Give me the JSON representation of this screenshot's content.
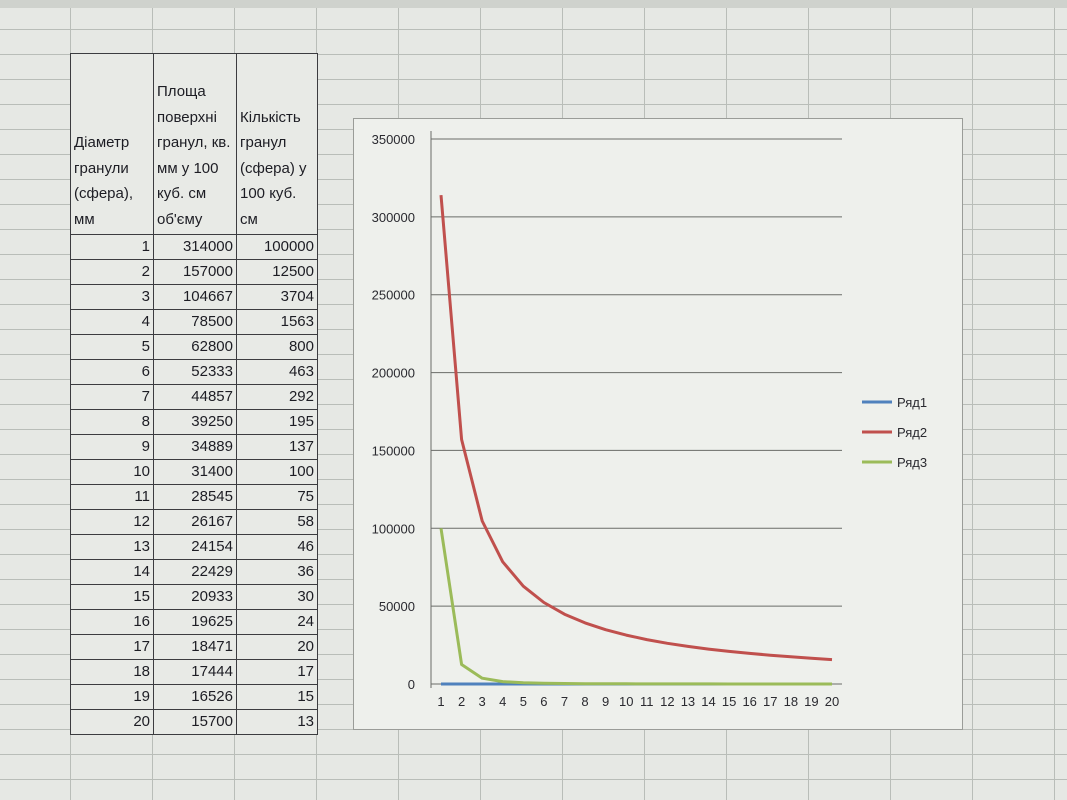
{
  "table": {
    "headers": [
      "Діаметр гранули (сфера), мм",
      "Площа поверхні гранул, кв. мм у 100 куб. см об'єму",
      "Кількість гранул (сфера) у 100 куб. см"
    ],
    "rows": [
      [
        1,
        314000,
        100000
      ],
      [
        2,
        157000,
        12500
      ],
      [
        3,
        104667,
        3704
      ],
      [
        4,
        78500,
        1563
      ],
      [
        5,
        62800,
        800
      ],
      [
        6,
        52333,
        463
      ],
      [
        7,
        44857,
        292
      ],
      [
        8,
        39250,
        195
      ],
      [
        9,
        34889,
        137
      ],
      [
        10,
        31400,
        100
      ],
      [
        11,
        28545,
        75
      ],
      [
        12,
        26167,
        58
      ],
      [
        13,
        24154,
        46
      ],
      [
        14,
        22429,
        36
      ],
      [
        15,
        20933,
        30
      ],
      [
        16,
        19625,
        24
      ],
      [
        17,
        18471,
        20
      ],
      [
        18,
        17444,
        17
      ],
      [
        19,
        16526,
        15
      ],
      [
        20,
        15700,
        13
      ]
    ]
  },
  "chart_data": {
    "type": "line",
    "x": [
      1,
      2,
      3,
      4,
      5,
      6,
      7,
      8,
      9,
      10,
      11,
      12,
      13,
      14,
      15,
      16,
      17,
      18,
      19,
      20
    ],
    "ylim": [
      0,
      350000
    ],
    "yticks": [
      0,
      50000,
      100000,
      150000,
      200000,
      250000,
      300000,
      350000
    ],
    "grid": true,
    "legend_position": "right",
    "series": [
      {
        "name": "Ряд1",
        "color": "#4f81bd",
        "values": [
          1,
          2,
          3,
          4,
          5,
          6,
          7,
          8,
          9,
          10,
          11,
          12,
          13,
          14,
          15,
          16,
          17,
          18,
          19,
          20
        ]
      },
      {
        "name": "Ряд2",
        "color": "#c0504d",
        "values": [
          314000,
          157000,
          104667,
          78500,
          62800,
          52333,
          44857,
          39250,
          34889,
          31400,
          28545,
          26167,
          24154,
          22429,
          20933,
          19625,
          18471,
          17444,
          16526,
          15700
        ]
      },
      {
        "name": "Ряд3",
        "color": "#9bbb59",
        "values": [
          100000,
          12500,
          3704,
          1563,
          800,
          463,
          292,
          195,
          137,
          100,
          75,
          58,
          46,
          36,
          30,
          24,
          20,
          17,
          15,
          13
        ]
      }
    ]
  }
}
